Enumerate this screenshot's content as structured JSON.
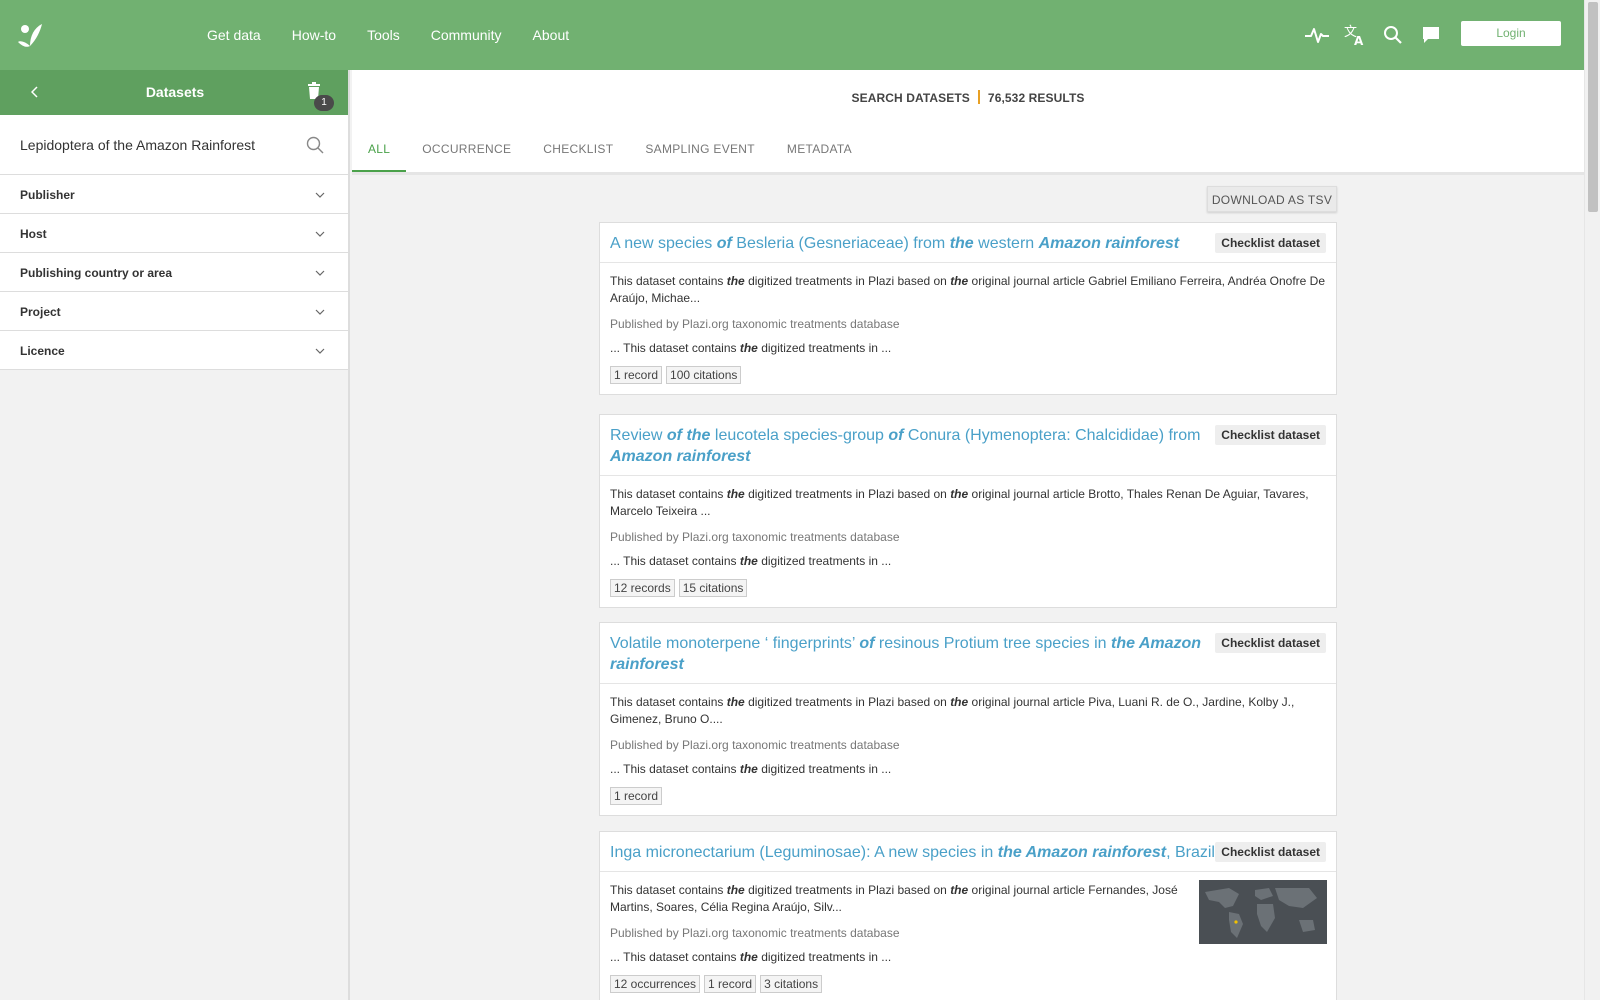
{
  "nav": {
    "items": [
      "Get data",
      "How-to",
      "Tools",
      "Community",
      "About"
    ],
    "login_label": "Login",
    "icons": [
      "pulse-icon",
      "translate-icon",
      "search-icon",
      "chat-icon"
    ]
  },
  "sidebar": {
    "title": "Datasets",
    "badge_count": "1",
    "search_value": "Lepidoptera of the Amazon Rainforest",
    "facets": [
      "Publisher",
      "Host",
      "Publishing country or area",
      "Project",
      "Licence"
    ]
  },
  "main": {
    "search_label": "SEARCH DATASETS",
    "results_count": "76,532 RESULTS",
    "tabs": [
      "ALL",
      "OCCURRENCE",
      "CHECKLIST",
      "SAMPLING EVENT",
      "METADATA"
    ],
    "download_label": "DOWNLOAD AS TSV"
  },
  "cards": [
    {
      "title_parts": [
        {
          "t": "A new species ",
          "hl": false
        },
        {
          "t": "of",
          "hl": true
        },
        {
          "t": " Besleria (Gesneriaceae) from ",
          "hl": false
        },
        {
          "t": "the",
          "hl": true
        },
        {
          "t": " western ",
          "hl": false
        },
        {
          "t": "Amazon rainforest",
          "hl": true
        }
      ],
      "type": "Checklist dataset",
      "desc_pre": "This dataset contains ",
      "desc_mid": " digitized treatments in Plazi based on ",
      "desc_post": " original journal article Gabriel Emiliano Ferreira, Andréa Onofre De Araújo, Michae...",
      "publisher": "Published by Plazi.org taxonomic treatments database",
      "snippet_pre": "... This dataset contains ",
      "snippet_post": " digitized treatments in ...",
      "chips": [
        "1 record",
        "100 citations"
      ],
      "hl_word": "the"
    },
    {
      "title_parts": [
        {
          "t": "Review ",
          "hl": false
        },
        {
          "t": "of the",
          "hl": true
        },
        {
          "t": " leucotela species-group ",
          "hl": false
        },
        {
          "t": "of",
          "hl": true
        },
        {
          "t": " Conura (Hymenoptera: Chalcididae) from ",
          "hl": false
        },
        {
          "t": "Amazon rainforest",
          "hl": true
        }
      ],
      "type": "Checklist dataset",
      "desc_pre": "This dataset contains ",
      "desc_mid": " digitized treatments in Plazi based on ",
      "desc_post": " original journal article Brotto, Thales Renan De Aguiar, Tavares, Marcelo Teixeira ...",
      "publisher": "Published by Plazi.org taxonomic treatments database",
      "snippet_pre": "... This dataset contains ",
      "snippet_post": " digitized treatments in ...",
      "chips": [
        "12 records",
        "15 citations"
      ],
      "hl_word": "the"
    },
    {
      "title_parts": [
        {
          "t": "Volatile monoterpene ‘ fingerprints’ ",
          "hl": false
        },
        {
          "t": "of",
          "hl": true
        },
        {
          "t": " resinous Protium tree species in ",
          "hl": false
        },
        {
          "t": "the Amazon rainforest",
          "hl": true
        }
      ],
      "type": "Checklist dataset",
      "desc_pre": "This dataset contains ",
      "desc_mid": " digitized treatments in Plazi based on ",
      "desc_post": " original journal article Piva, Luani R. de O., Jardine, Kolby J., Gimenez, Bruno O....",
      "publisher": "Published by Plazi.org taxonomic treatments database",
      "snippet_pre": "... This dataset contains ",
      "snippet_post": " digitized treatments in ...",
      "chips": [
        "1 record"
      ],
      "hl_word": "the"
    },
    {
      "title_parts": [
        {
          "t": "Inga micronectarium (Leguminosae): A new species in ",
          "hl": false
        },
        {
          "t": "the Amazon rainforest",
          "hl": true
        },
        {
          "t": ", Brazil",
          "hl": false
        }
      ],
      "type": "Checklist dataset",
      "desc_pre": "This dataset contains ",
      "desc_mid": " digitized treatments in Plazi based on ",
      "desc_post": " original journal article Fernandes, José Martins, Soares, Célia Regina Araújo, Silv...",
      "publisher": "Published by Plazi.org taxonomic treatments database",
      "snippet_pre": "... This dataset contains ",
      "snippet_post": " digitized treatments in ...",
      "chips": [
        "12 occurrences",
        "1 record",
        "3 citations"
      ],
      "hl_word": "the",
      "has_map": true
    }
  ],
  "colors": {
    "brand_green": "#71b171",
    "link_blue": "#4aa0c8",
    "accent_orange": "#e8a024"
  }
}
